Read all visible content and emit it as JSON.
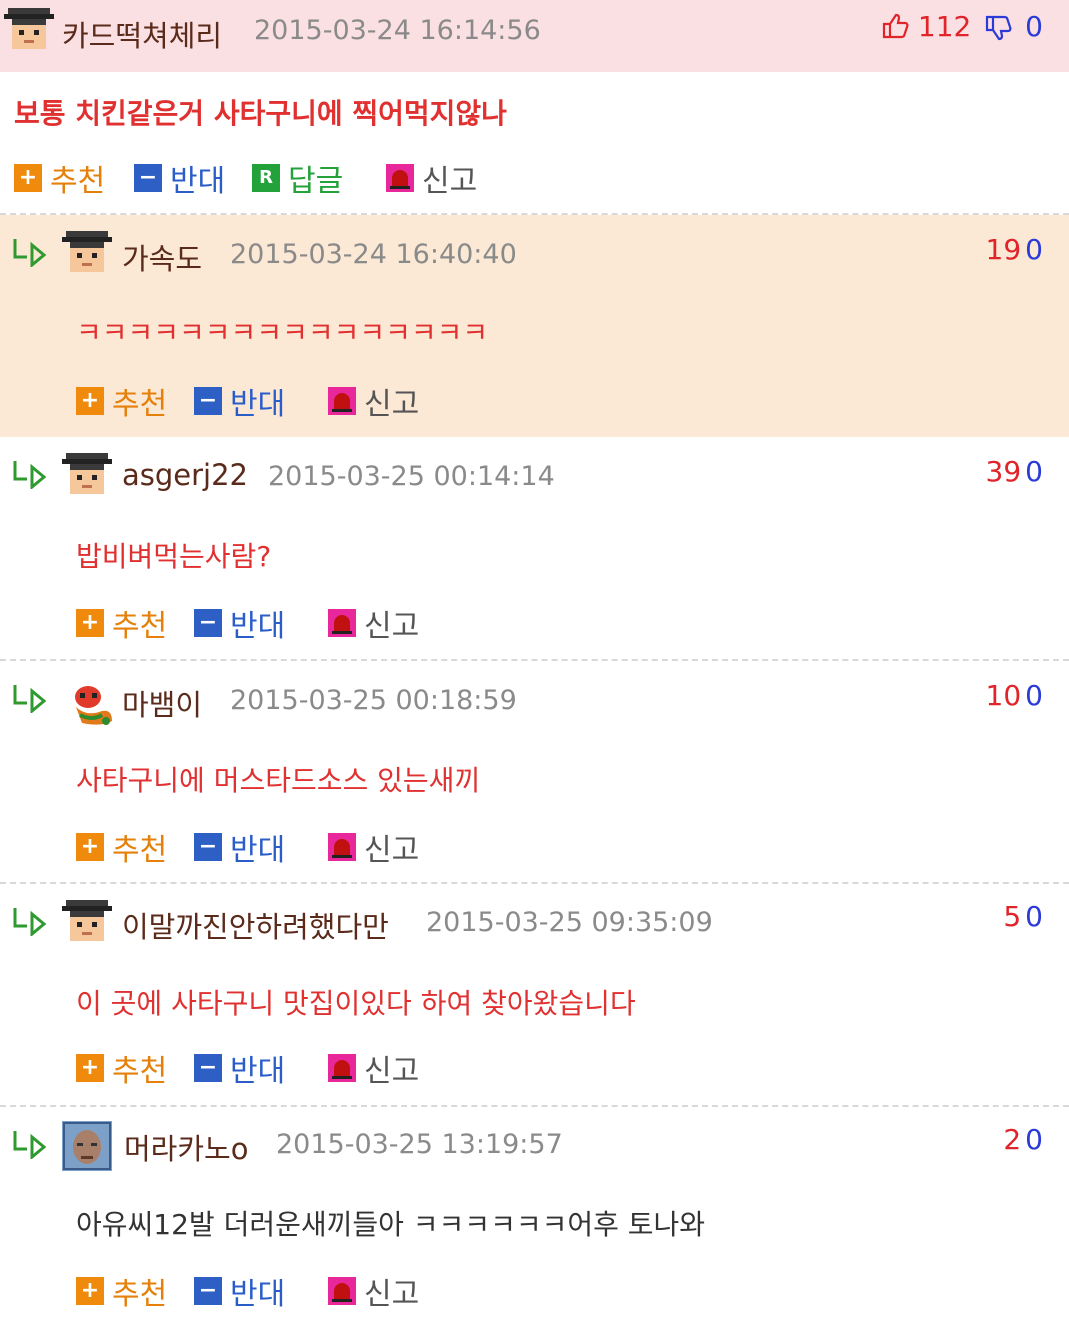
{
  "comments": [
    {
      "nick": "카드떡쳐체리",
      "date": "2015-03-24 16:14:56",
      "up": "112",
      "down": "0",
      "text": "보통 치킨같은거 사타구니에 찍어먹지않나",
      "actions": {
        "recommend": "추천",
        "oppose": "반대",
        "reply": "답글",
        "report": "신고"
      }
    },
    {
      "nick": "가속도",
      "date": "2015-03-24 16:40:40",
      "up": "19",
      "down": "0",
      "text": "ㅋㅋㅋㅋㅋㅋㅋㅋㅋㅋㅋㅋㅋㅋㅋㅋ",
      "actions": {
        "recommend": "추천",
        "oppose": "반대",
        "report": "신고"
      }
    },
    {
      "nick": "asgerj22",
      "date": "2015-03-25 00:14:14",
      "up": "39",
      "down": "0",
      "text": "밥비벼먹는사람?",
      "actions": {
        "recommend": "추천",
        "oppose": "반대",
        "report": "신고"
      }
    },
    {
      "nick": "마뱀이",
      "date": "2015-03-25 00:18:59",
      "up": "10",
      "down": "0",
      "text": "사타구니에 머스타드소스 있는새끼",
      "actions": {
        "recommend": "추천",
        "oppose": "반대",
        "report": "신고"
      }
    },
    {
      "nick": "이말까진안하려했다만",
      "date": "2015-03-25 09:35:09",
      "up": "5",
      "down": "0",
      "text": "이 곳에 사타구니 맛집이있다 하여 찾아왔습니다",
      "actions": {
        "recommend": "추천",
        "oppose": "반대",
        "report": "신고"
      }
    },
    {
      "nick": "머라카노o",
      "date": "2015-03-25 13:19:57",
      "up": "2",
      "down": "0",
      "text": "아유씨12발 더러운새끼들아 ㅋㅋㅋㅋㅋㅋ어후 토나와",
      "actions": {
        "recommend": "추천",
        "oppose": "반대",
        "report": "신고"
      }
    }
  ],
  "colors": {
    "best_header": "#fbe0e3",
    "highlight_reply": "#fbe8d5",
    "accent_red": "#e03030",
    "up_red": "#e0242a",
    "down_blue": "#2a3bd6"
  },
  "icons": {
    "thumb_up": "thumb-up-icon",
    "thumb_down": "thumb-down-icon",
    "reply_arrow": "reply-arrow-icon",
    "recommend": "plus-icon",
    "oppose": "minus-icon",
    "reply": "reply-r-icon",
    "report": "siren-icon"
  }
}
